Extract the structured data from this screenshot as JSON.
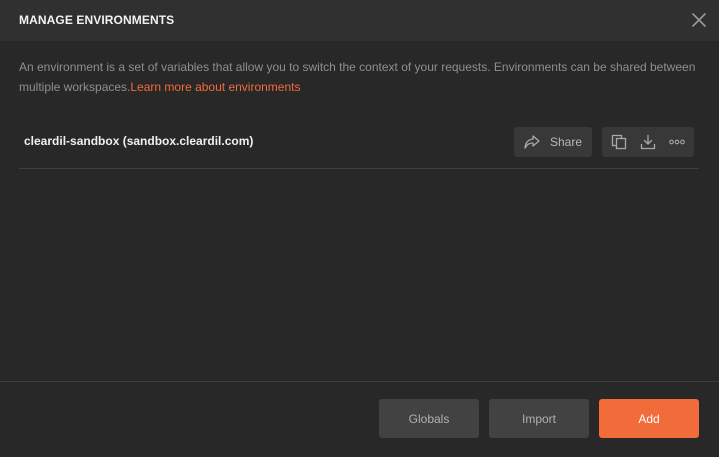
{
  "header": {
    "title": "MANAGE ENVIRONMENTS",
    "close_icon": "close-icon"
  },
  "description": {
    "text": "An environment is a set of variables that allow you to switch the context of your requests. Environments can be shared between multiple workspaces.",
    "link_text": "Learn more about environments"
  },
  "environments": [
    {
      "name": "cleardil-sandbox (sandbox.cleardil.com)",
      "share_label": "Share",
      "icons": [
        "share-icon",
        "duplicate-icon",
        "download-icon",
        "more-icon"
      ]
    }
  ],
  "footer": {
    "globals_label": "Globals",
    "import_label": "Import",
    "add_label": "Add"
  },
  "colors": {
    "accent": "#f26b3a",
    "background": "#282828",
    "header_background": "#303030"
  }
}
